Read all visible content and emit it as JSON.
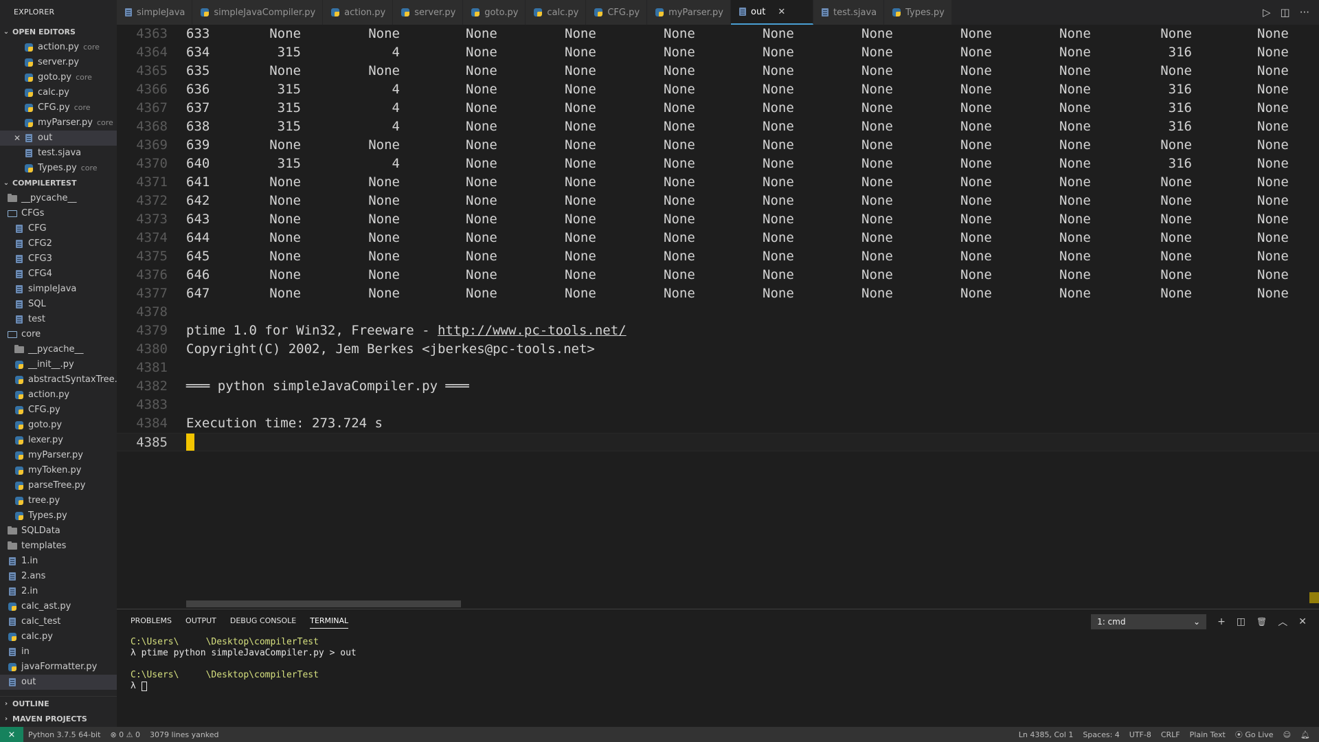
{
  "sidebar": {
    "title": "EXPLORER",
    "open_editors": {
      "title": "OPEN EDITORS",
      "items": [
        {
          "name": "action.py",
          "desc": "core",
          "icon": "python-icon"
        },
        {
          "name": "server.py",
          "desc": "",
          "icon": "python-icon"
        },
        {
          "name": "goto.py",
          "desc": "core",
          "icon": "python-icon"
        },
        {
          "name": "calc.py",
          "desc": "",
          "icon": "python-icon"
        },
        {
          "name": "CFG.py",
          "desc": "core",
          "icon": "python-icon"
        },
        {
          "name": "myParser.py",
          "desc": "core",
          "icon": "python-icon"
        },
        {
          "name": "out",
          "desc": "",
          "icon": "file-icon",
          "active": true,
          "close": "✕"
        },
        {
          "name": "test.sjava",
          "desc": "",
          "icon": "file-icon"
        },
        {
          "name": "Types.py",
          "desc": "core",
          "icon": "python-icon"
        }
      ]
    },
    "project": {
      "title": "COMPILERTEST",
      "items": [
        {
          "name": "__pycache__",
          "icon": "folder-icon",
          "depth": 0
        },
        {
          "name": "CFGs",
          "icon": "folder-open-icon",
          "depth": 0
        },
        {
          "name": "CFG",
          "icon": "file-icon",
          "depth": 1
        },
        {
          "name": "CFG2",
          "icon": "file-icon",
          "depth": 1
        },
        {
          "name": "CFG3",
          "icon": "file-icon",
          "depth": 1
        },
        {
          "name": "CFG4",
          "icon": "file-icon",
          "depth": 1
        },
        {
          "name": "simpleJava",
          "icon": "file-icon",
          "depth": 1
        },
        {
          "name": "SQL",
          "icon": "file-icon",
          "depth": 1
        },
        {
          "name": "test",
          "icon": "file-icon",
          "depth": 1
        },
        {
          "name": "core",
          "icon": "folder-open-icon",
          "depth": 0
        },
        {
          "name": "__pycache__",
          "icon": "folder-icon",
          "depth": 1
        },
        {
          "name": "__init__.py",
          "icon": "python-icon",
          "depth": 1
        },
        {
          "name": "abstractSyntaxTree.py",
          "icon": "python-icon",
          "depth": 1
        },
        {
          "name": "action.py",
          "icon": "python-icon",
          "depth": 1
        },
        {
          "name": "CFG.py",
          "icon": "python-icon",
          "depth": 1
        },
        {
          "name": "goto.py",
          "icon": "python-icon",
          "depth": 1
        },
        {
          "name": "lexer.py",
          "icon": "python-icon",
          "depth": 1
        },
        {
          "name": "myParser.py",
          "icon": "python-icon",
          "depth": 1
        },
        {
          "name": "myToken.py",
          "icon": "python-icon",
          "depth": 1
        },
        {
          "name": "parseTree.py",
          "icon": "python-icon",
          "depth": 1
        },
        {
          "name": "tree.py",
          "icon": "python-icon",
          "depth": 1
        },
        {
          "name": "Types.py",
          "icon": "python-icon",
          "depth": 1
        },
        {
          "name": "SQLData",
          "icon": "folder-icon",
          "depth": 0
        },
        {
          "name": "templates",
          "icon": "folder-icon",
          "depth": 0
        },
        {
          "name": "1.in",
          "icon": "file-icon",
          "depth": 0
        },
        {
          "name": "2.ans",
          "icon": "file-icon",
          "depth": 0
        },
        {
          "name": "2.in",
          "icon": "file-icon",
          "depth": 0
        },
        {
          "name": "calc_ast.py",
          "icon": "python-icon",
          "depth": 0
        },
        {
          "name": "calc_test",
          "icon": "file-icon",
          "depth": 0
        },
        {
          "name": "calc.py",
          "icon": "python-icon",
          "depth": 0
        },
        {
          "name": "in",
          "icon": "file-icon",
          "depth": 0
        },
        {
          "name": "javaFormatter.py",
          "icon": "python-icon",
          "depth": 0
        },
        {
          "name": "out",
          "icon": "file-icon",
          "depth": 0,
          "active": true
        }
      ]
    },
    "outline": "OUTLINE",
    "maven": "MAVEN PROJECTS"
  },
  "tabs": [
    {
      "label": "simpleJava",
      "icon": "file-icon"
    },
    {
      "label": "simpleJavaCompiler.py",
      "icon": "python-icon"
    },
    {
      "label": "action.py",
      "icon": "python-icon"
    },
    {
      "label": "server.py",
      "icon": "python-icon"
    },
    {
      "label": "goto.py",
      "icon": "python-icon"
    },
    {
      "label": "calc.py",
      "icon": "python-icon"
    },
    {
      "label": "CFG.py",
      "icon": "python-icon"
    },
    {
      "label": "myParser.py",
      "icon": "python-icon"
    },
    {
      "label": "out",
      "icon": "file-icon",
      "active": true,
      "close": "✕"
    },
    {
      "label": "test.sjava",
      "icon": "file-icon"
    },
    {
      "label": "Types.py",
      "icon": "python-icon"
    }
  ],
  "tab_actions": {
    "run": "▷",
    "split": "◫",
    "more": "···"
  },
  "editor": {
    "table_rows": [
      {
        "ln": "4363",
        "cells": [
          "633",
          "None",
          "None",
          "None",
          "None",
          "None",
          "None",
          "None",
          "None",
          "None",
          "None",
          "None"
        ]
      },
      {
        "ln": "4364",
        "cells": [
          "634",
          "315",
          "4",
          "None",
          "None",
          "None",
          "None",
          "None",
          "None",
          "None",
          "316",
          "None"
        ]
      },
      {
        "ln": "4365",
        "cells": [
          "635",
          "None",
          "None",
          "None",
          "None",
          "None",
          "None",
          "None",
          "None",
          "None",
          "None",
          "None"
        ]
      },
      {
        "ln": "4366",
        "cells": [
          "636",
          "315",
          "4",
          "None",
          "None",
          "None",
          "None",
          "None",
          "None",
          "None",
          "316",
          "None"
        ]
      },
      {
        "ln": "4367",
        "cells": [
          "637",
          "315",
          "4",
          "None",
          "None",
          "None",
          "None",
          "None",
          "None",
          "None",
          "316",
          "None"
        ]
      },
      {
        "ln": "4368",
        "cells": [
          "638",
          "315",
          "4",
          "None",
          "None",
          "None",
          "None",
          "None",
          "None",
          "None",
          "316",
          "None"
        ]
      },
      {
        "ln": "4369",
        "cells": [
          "639",
          "None",
          "None",
          "None",
          "None",
          "None",
          "None",
          "None",
          "None",
          "None",
          "None",
          "None"
        ]
      },
      {
        "ln": "4370",
        "cells": [
          "640",
          "315",
          "4",
          "None",
          "None",
          "None",
          "None",
          "None",
          "None",
          "None",
          "316",
          "None"
        ]
      },
      {
        "ln": "4371",
        "cells": [
          "641",
          "None",
          "None",
          "None",
          "None",
          "None",
          "None",
          "None",
          "None",
          "None",
          "None",
          "None"
        ]
      },
      {
        "ln": "4372",
        "cells": [
          "642",
          "None",
          "None",
          "None",
          "None",
          "None",
          "None",
          "None",
          "None",
          "None",
          "None",
          "None"
        ]
      },
      {
        "ln": "4373",
        "cells": [
          "643",
          "None",
          "None",
          "None",
          "None",
          "None",
          "None",
          "None",
          "None",
          "None",
          "None",
          "None"
        ]
      },
      {
        "ln": "4374",
        "cells": [
          "644",
          "None",
          "None",
          "None",
          "None",
          "None",
          "None",
          "None",
          "None",
          "None",
          "None",
          "None"
        ]
      },
      {
        "ln": "4375",
        "cells": [
          "645",
          "None",
          "None",
          "None",
          "None",
          "None",
          "None",
          "None",
          "None",
          "None",
          "None",
          "None"
        ]
      },
      {
        "ln": "4376",
        "cells": [
          "646",
          "None",
          "None",
          "None",
          "None",
          "None",
          "None",
          "None",
          "None",
          "None",
          "None",
          "None"
        ]
      },
      {
        "ln": "4377",
        "cells": [
          "647",
          "None",
          "None",
          "None",
          "None",
          "None",
          "None",
          "None",
          "None",
          "None",
          "None",
          "None"
        ]
      }
    ],
    "text_lines": [
      {
        "ln": "4378",
        "text": ""
      },
      {
        "ln": "4379",
        "text": "ptime 1.0 for Win32, Freeware - ",
        "link": "http://www.pc-tools.net/"
      },
      {
        "ln": "4380",
        "text": "Copyright(C) 2002, Jem Berkes <jberkes@pc-tools.net>"
      },
      {
        "ln": "4381",
        "text": ""
      },
      {
        "ln": "4382",
        "text": "═══ python simpleJavaCompiler.py ═══"
      },
      {
        "ln": "4383",
        "text": ""
      },
      {
        "ln": "4384",
        "text": "Execution time: 273.724 s"
      },
      {
        "ln": "4385",
        "text": "",
        "cursor": true
      }
    ]
  },
  "panel": {
    "tabs": [
      "PROBLEMS",
      "OUTPUT",
      "DEBUG CONSOLE",
      "TERMINAL"
    ],
    "active_tab": 3,
    "terminal_select": "1: cmd",
    "actions": {
      "add": "+",
      "split": "◫",
      "trash": "🗑",
      "maximize": "︿",
      "close": "✕"
    },
    "terminal_lines": [
      {
        "prompt_path": "C:\\Users\\     \\Desktop\\compilerTest"
      },
      {
        "text": "λ ptime python simpleJavaCompiler.py > out"
      },
      {
        "text": ""
      },
      {
        "prompt_path": "C:\\Users\\     \\Desktop\\compilerTest"
      },
      {
        "text": "λ ",
        "cursor": true
      }
    ]
  },
  "status": {
    "python": "Python 3.7.5 64-bit",
    "problems": "⊗ 0 ⚠ 0",
    "message": "3079 lines yanked",
    "position": "Ln 4385, Col 1",
    "spaces": "Spaces: 4",
    "encoding": "UTF-8",
    "eol": "CRLF",
    "language": "Plain Text",
    "golive": "Go Live",
    "colors": {
      "remote_bg": "#16825d",
      "bar_bg": "#333333",
      "tab_active_border": "#4a9fd4",
      "cursor": "#f2c400"
    }
  }
}
